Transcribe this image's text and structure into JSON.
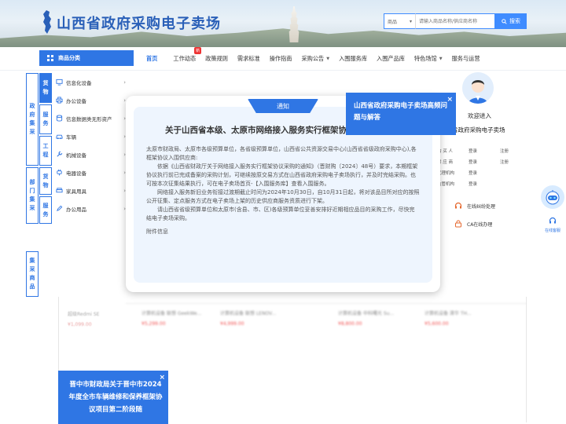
{
  "header": {
    "site_title": "山西省政府采购电子卖场",
    "search": {
      "select_value": "商品",
      "placeholder": "请输入商品名称/供应商名称",
      "button_label": "搜索"
    }
  },
  "nav": {
    "category_button": "商品分类",
    "items": [
      {
        "label": "首页",
        "active": true
      },
      {
        "label": "工作动态",
        "badge": "新"
      },
      {
        "label": "政策规则"
      },
      {
        "label": "需求标准"
      },
      {
        "label": "操作指南"
      },
      {
        "label": "采购公告",
        "caret": "▼"
      },
      {
        "label": "入围服务库"
      },
      {
        "label": "入围产品库"
      },
      {
        "label": "特色场馆",
        "caret": "▼"
      },
      {
        "label": "服务与运营"
      }
    ]
  },
  "left_tabs": {
    "gov": [
      "政",
      "府",
      "集",
      "采"
    ],
    "goods1": [
      "货",
      "物"
    ],
    "service1": [
      "服",
      "务"
    ],
    "eng": [
      "工",
      "程"
    ],
    "dept": [
      "部",
      "门",
      "集",
      "采"
    ],
    "goods2": [
      "货",
      "物"
    ],
    "service2": [
      "服",
      "务"
    ],
    "collect": [
      "集",
      "采",
      "商",
      "品"
    ]
  },
  "categories": [
    {
      "label": "信息化设备",
      "icon": "monitor-icon"
    },
    {
      "label": "办公设备",
      "icon": "printer-icon"
    },
    {
      "label": "信息数据类无形资产",
      "icon": "database-icon"
    },
    {
      "label": "车辆",
      "icon": "car-icon"
    },
    {
      "label": "机械设备",
      "icon": "wrench-icon"
    },
    {
      "label": "电器设备",
      "icon": "plug-icon"
    },
    {
      "label": "家具用具",
      "icon": "sofa-icon"
    },
    {
      "label": "办公用品",
      "icon": "pen-icon"
    }
  ],
  "user_panel": {
    "welcome": "欢迎进入",
    "welcome_site": "山西省政府采购电子卖场",
    "roles": [
      {
        "name": "购 买 人",
        "a": "登录",
        "b": "注册"
      },
      {
        "name": "供 应 商",
        "a": "登录",
        "b": "注册"
      },
      {
        "name": "代理机构",
        "a": "登录",
        "b": ""
      },
      {
        "name": "监管机构",
        "a": "登录",
        "b": ""
      }
    ],
    "services": [
      {
        "label": "在线纠纷处理",
        "icon": "headset-icon"
      },
      {
        "label": "CA在线办理",
        "icon": "ca-icon"
      }
    ]
  },
  "robot": {
    "label": "在线客服"
  },
  "products": [
    {
      "name": "超级Redmi SE",
      "price": "¥1,099.00"
    },
    {
      "name": "计算机设备 联想 GeekWe...",
      "price": "¥5,299.00"
    },
    {
      "name": "计算机设备 联想 LENOV...",
      "price": "¥4,999.00"
    },
    {
      "name": "计算机设备 中科曙光 Su...",
      "price": "¥8,800.00"
    },
    {
      "name": "计算机设备 清华 TH...",
      "price": "¥5,600.00"
    }
  ],
  "modal": {
    "tab": "通知",
    "title": "关于山西省本级、太原市网络接入服务实行框架协议采购的通知",
    "paragraphs": [
      "太原市财政局、太原市各级预算单位，各省级预算单位，山西省公共资源交易中心(山西省省级政府采购中心),各框架协议入围供应商:",
      "依据《山西省财政厅关于网络接入服务实行框架协议采购的通知》（晋财购〔2024〕48号）要求，本期框架协议执行前已完成备案的采购计划，可继续按原交易方式在山西省政府采购电子卖场执行，并及时完结采购。也可按本次征集结果执行，可在电子卖场首页-【入围服务库】查看入围服务。",
      "网络接入服务新旧业务衔接过渡期截止时间为2024年10月30日，自10月31日起，将对该品目所对应的按照公开征集、定点服务方式在电子卖场上架的历史供应商服务资质进行下架。",
      "请山西省省级预算单位和太原市(含县、市、区)各级预算单位妥善安排好近期相应品目的采购工作，尽快完结电子卖场采购。"
    ],
    "attachment": "附件信息"
  },
  "popup_right": {
    "text": "山西省政府采购电子卖场高频问题与解答",
    "close": "×"
  },
  "popup_bottom": {
    "text": "晋中市财政局关于晋中市2024年度全市车辆维修和保养框架协议项目第二阶段随",
    "close": "×"
  },
  "colors": {
    "brand": "#2f76e4",
    "title": "#2a60b8",
    "price": "#e33333"
  }
}
